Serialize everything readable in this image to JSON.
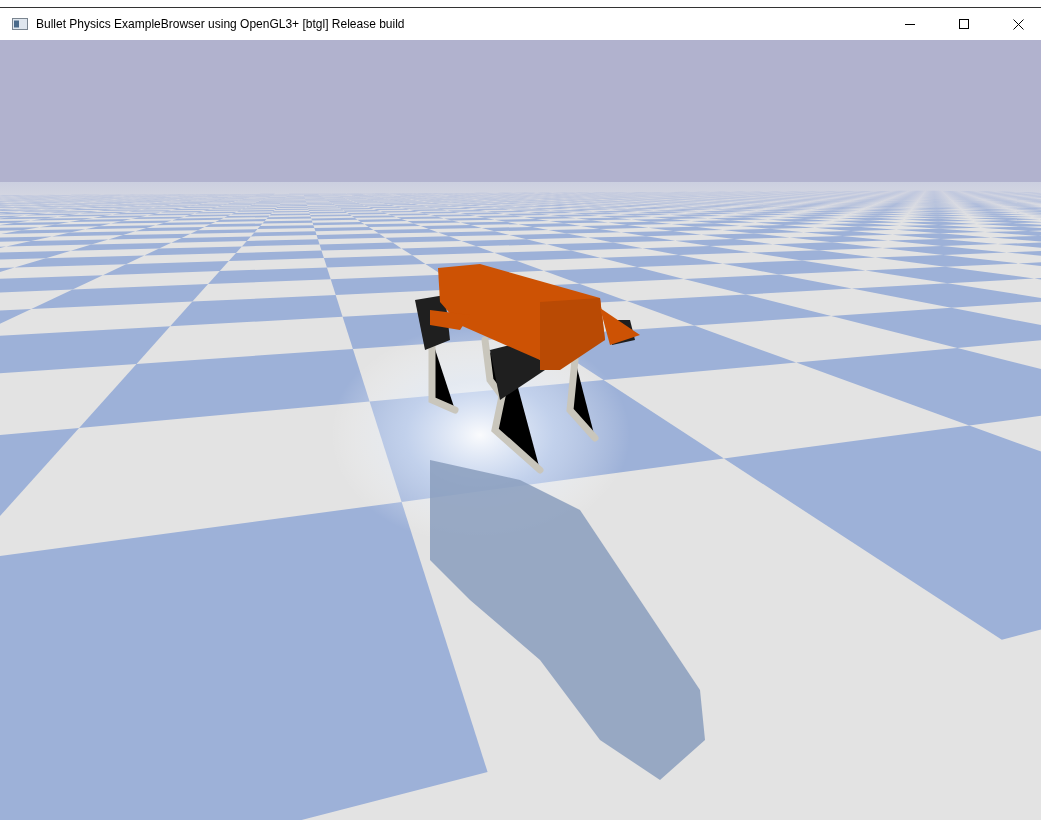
{
  "window": {
    "title": "Bullet Physics ExampleBrowser using OpenGL3+ [btgl] Release build"
  }
}
